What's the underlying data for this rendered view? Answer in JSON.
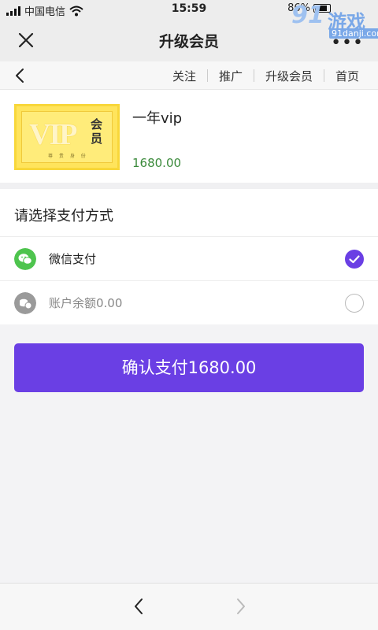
{
  "status_bar": {
    "carrier": "中国电信",
    "time": "15:59",
    "battery_percent": "86%"
  },
  "watermark": {
    "logo_number": "91",
    "logo_text": "游戏",
    "logo_url_text": "91danji.com"
  },
  "titlebar": {
    "title": "升级会员",
    "more_label": "•••"
  },
  "nav": {
    "links": [
      "关注",
      "推广",
      "升级会员",
      "首页"
    ]
  },
  "product": {
    "image": {
      "vip_text": "VIP",
      "member_text": "会员",
      "sub_text": "尊 贵 身 份"
    },
    "name": "一年vip",
    "price": "1680.00"
  },
  "payment": {
    "heading": "请选择支付方式",
    "options": [
      {
        "label": "微信支付",
        "icon": "wechat-pay-icon",
        "selected": true
      },
      {
        "label": "账户余额0.00",
        "icon": "balance-coin-icon",
        "selected": false
      }
    ]
  },
  "confirm_button": {
    "label": "确认支付1680.00"
  },
  "colors": {
    "accent": "#6a3fe4",
    "price_green": "#3b8a3b",
    "wechat_green": "#4ec44e",
    "balance_gray": "#9a9a9a"
  }
}
